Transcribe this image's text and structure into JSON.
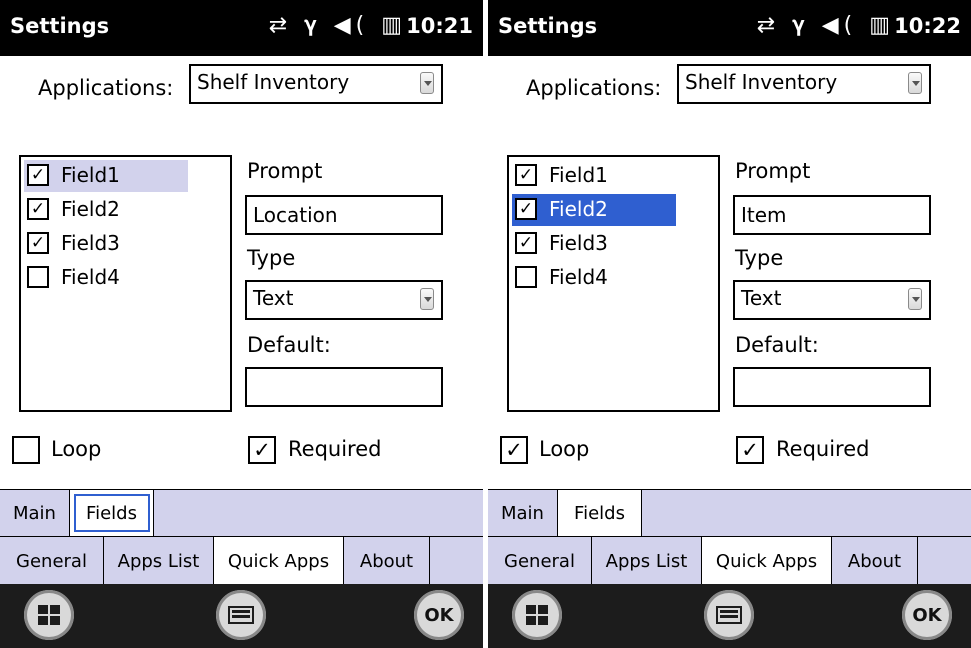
{
  "status_icons": "⇄ 𝛄 ◀( ▥",
  "screens": [
    {
      "title": "Settings",
      "time": "10:21",
      "applications_label": "Applications:",
      "application_value": "Shelf Inventory",
      "fields": [
        {
          "label": "Field1",
          "checked": "✓"
        },
        {
          "label": "Field2",
          "checked": "✓"
        },
        {
          "label": "Field3",
          "checked": "✓"
        },
        {
          "label": "Field4",
          "checked": ""
        }
      ],
      "prompt_label": "Prompt",
      "prompt_value": "Location",
      "type_label": "Type",
      "type_value": "Text",
      "default_label": "Default:",
      "default_value": "",
      "loop_label": "Loop",
      "loop_checked": "",
      "required_label": "Required",
      "required_checked": "✓",
      "tabs_top": [
        "Main",
        "Fields"
      ],
      "tabs_bottom": [
        "General",
        "Apps List",
        "Quick Apps",
        "About"
      ]
    },
    {
      "title": "Settings",
      "time": "10:22",
      "applications_label": "Applications:",
      "application_value": "Shelf Inventory",
      "fields": [
        {
          "label": "Field1",
          "checked": "✓"
        },
        {
          "label": "Field2",
          "checked": "✓"
        },
        {
          "label": "Field3",
          "checked": "✓"
        },
        {
          "label": "Field4",
          "checked": ""
        }
      ],
      "prompt_label": "Prompt",
      "prompt_value": "Item",
      "type_label": "Type",
      "type_value": "Text",
      "default_label": "Default:",
      "default_value": "",
      "loop_label": "Loop",
      "loop_checked": "✓",
      "required_label": "Required",
      "required_checked": "✓",
      "tabs_top": [
        "Main",
        "Fields"
      ],
      "tabs_bottom": [
        "General",
        "Apps List",
        "Quick Apps",
        "About"
      ]
    }
  ],
  "softkeys": {
    "start": "windows-logo",
    "keyboard": "keyboard",
    "ok": "OK"
  },
  "colors": {
    "tab_bg": "#d2d2ec",
    "selection": "#2f5fd0",
    "statusbar": "#000000"
  }
}
